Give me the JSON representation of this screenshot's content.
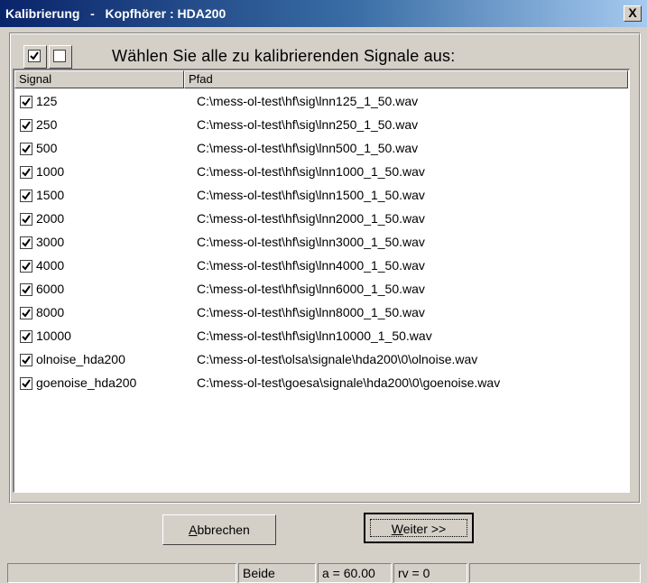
{
  "window": {
    "title": "Kalibrierung   -   Kopfhörer : HDA200",
    "close_label": "X"
  },
  "toolbar": {
    "select_all_checked": true,
    "select_none_checked": false,
    "instruction": "Wählen Sie alle zu kalibrierenden Signale aus:"
  },
  "table": {
    "columns": [
      "Signal",
      "Pfad"
    ],
    "rows": [
      {
        "signal": "125",
        "pfad": "C:\\mess-ol-test\\hf\\sig\\lnn125_1_50.wav",
        "checked": true
      },
      {
        "signal": "250",
        "pfad": "C:\\mess-ol-test\\hf\\sig\\lnn250_1_50.wav",
        "checked": true
      },
      {
        "signal": "500",
        "pfad": "C:\\mess-ol-test\\hf\\sig\\lnn500_1_50.wav",
        "checked": true
      },
      {
        "signal": "1000",
        "pfad": "C:\\mess-ol-test\\hf\\sig\\lnn1000_1_50.wav",
        "checked": true
      },
      {
        "signal": "1500",
        "pfad": "C:\\mess-ol-test\\hf\\sig\\lnn1500_1_50.wav",
        "checked": true
      },
      {
        "signal": "2000",
        "pfad": "C:\\mess-ol-test\\hf\\sig\\lnn2000_1_50.wav",
        "checked": true
      },
      {
        "signal": "3000",
        "pfad": "C:\\mess-ol-test\\hf\\sig\\lnn3000_1_50.wav",
        "checked": true
      },
      {
        "signal": "4000",
        "pfad": "C:\\mess-ol-test\\hf\\sig\\lnn4000_1_50.wav",
        "checked": true
      },
      {
        "signal": "6000",
        "pfad": "C:\\mess-ol-test\\hf\\sig\\lnn6000_1_50.wav",
        "checked": true
      },
      {
        "signal": "8000",
        "pfad": "C:\\mess-ol-test\\hf\\sig\\lnn8000_1_50.wav",
        "checked": true
      },
      {
        "signal": "10000",
        "pfad": "C:\\mess-ol-test\\hf\\sig\\lnn10000_1_50.wav",
        "checked": true
      },
      {
        "signal": "olnoise_hda200",
        "pfad": "C:\\mess-ol-test\\olsa\\signale\\hda200\\0\\olnoise.wav",
        "checked": true
      },
      {
        "signal": "goenoise_hda200",
        "pfad": "C:\\mess-ol-test\\goesa\\signale\\hda200\\0\\goenoise.wav",
        "checked": true
      }
    ]
  },
  "buttons": {
    "cancel": {
      "mnemonic": "A",
      "rest": "bbrechen"
    },
    "next": {
      "mnemonic": "W",
      "rest": "eiter >>"
    }
  },
  "statusbar": {
    "cells": [
      "",
      "Beide",
      "a = 60.00",
      "rv = 0",
      ""
    ]
  }
}
